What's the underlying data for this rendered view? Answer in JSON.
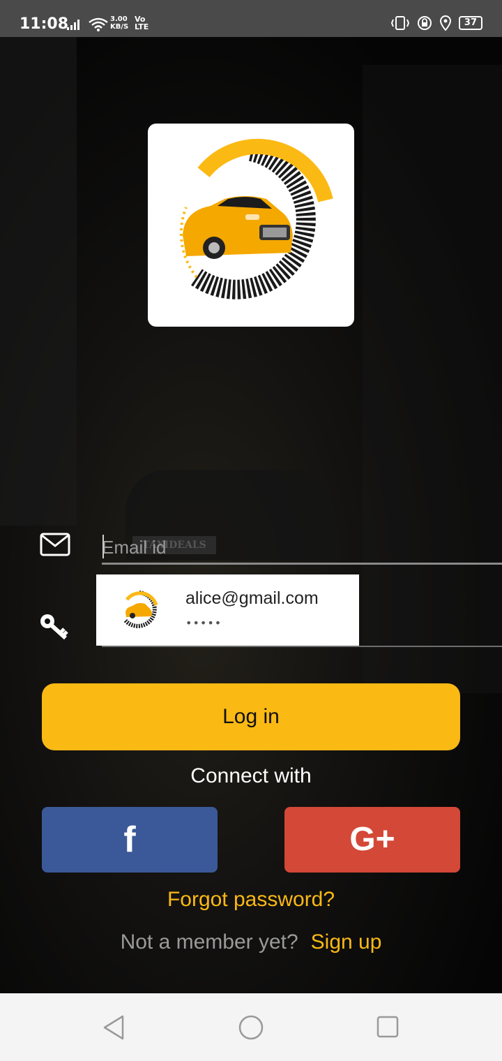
{
  "status_bar": {
    "time": "11:08",
    "speed_value": "3.00",
    "speed_unit": "KB/S",
    "network_top": "Vo",
    "network_bottom": "LTE",
    "battery": "37"
  },
  "background": {
    "sign_text": "TAXIDEALS"
  },
  "login": {
    "email_placeholder": "Email id",
    "autofill_email": "alice@gmail.com",
    "autofill_password_mask": "•••••",
    "login_label": "Log in",
    "connect_label": "Connect with",
    "facebook_label": "f",
    "google_label": "G+",
    "forgot_label": "Forgot password?",
    "not_member_label": "Not a member yet?",
    "signup_label": "Sign up"
  },
  "colors": {
    "accent": "#fbb914",
    "facebook": "#3b5998",
    "google": "#d34836"
  }
}
